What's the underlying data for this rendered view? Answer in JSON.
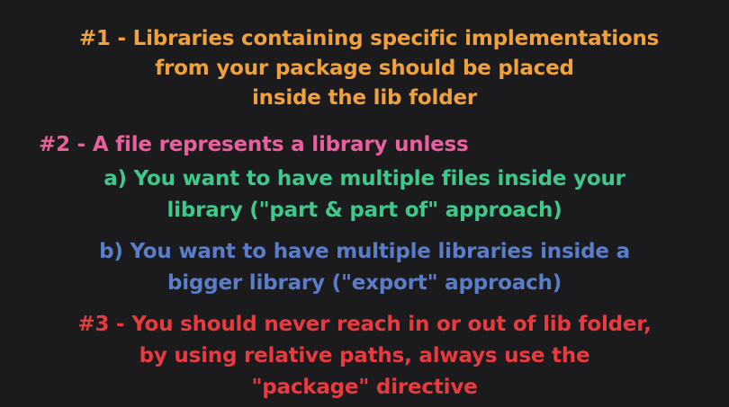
{
  "rule1": {
    "lines": [
      "#1 - Libraries containing specific implementations",
      "from your package should be placed",
      "inside the lib folder"
    ]
  },
  "rule2": {
    "heading": "#2 - A file represents a library unless",
    "a": {
      "lines": [
        "a) You want to have multiple files inside your",
        "library (\"part & part of\" approach)"
      ]
    },
    "b": {
      "lines": [
        "b) You want to have multiple libraries inside a",
        "bigger library (\"export\" approach)"
      ]
    }
  },
  "rule3": {
    "lines": [
      "#3 - You should never reach in or out of lib folder,",
      "by using relative paths, always use the",
      "\"package\" directive"
    ]
  },
  "colors": {
    "background": "#1b1b1d",
    "rule1": "#efa13b",
    "rule2": "#e9609e",
    "rule2a": "#3ec98a",
    "rule2b": "#5b7dc9",
    "rule3": "#e93a3f"
  }
}
